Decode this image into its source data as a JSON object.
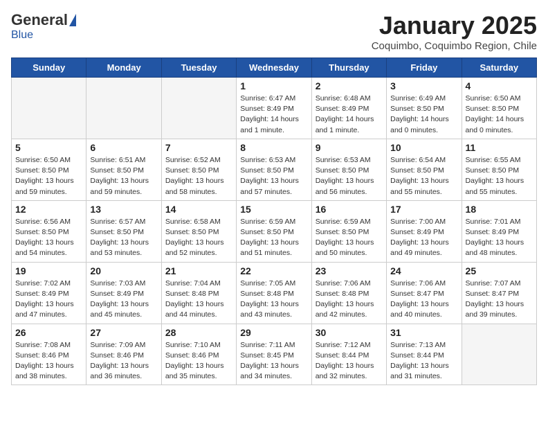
{
  "header": {
    "logo_general": "General",
    "logo_blue": "Blue",
    "title": "January 2025",
    "subtitle": "Coquimbo, Coquimbo Region, Chile"
  },
  "days_of_week": [
    "Sunday",
    "Monday",
    "Tuesday",
    "Wednesday",
    "Thursday",
    "Friday",
    "Saturday"
  ],
  "weeks": [
    [
      {
        "day": "",
        "info": ""
      },
      {
        "day": "",
        "info": ""
      },
      {
        "day": "",
        "info": ""
      },
      {
        "day": "1",
        "info": "Sunrise: 6:47 AM\nSunset: 8:49 PM\nDaylight: 14 hours\nand 1 minute."
      },
      {
        "day": "2",
        "info": "Sunrise: 6:48 AM\nSunset: 8:49 PM\nDaylight: 14 hours\nand 1 minute."
      },
      {
        "day": "3",
        "info": "Sunrise: 6:49 AM\nSunset: 8:50 PM\nDaylight: 14 hours\nand 0 minutes."
      },
      {
        "day": "4",
        "info": "Sunrise: 6:50 AM\nSunset: 8:50 PM\nDaylight: 14 hours\nand 0 minutes."
      }
    ],
    [
      {
        "day": "5",
        "info": "Sunrise: 6:50 AM\nSunset: 8:50 PM\nDaylight: 13 hours\nand 59 minutes."
      },
      {
        "day": "6",
        "info": "Sunrise: 6:51 AM\nSunset: 8:50 PM\nDaylight: 13 hours\nand 59 minutes."
      },
      {
        "day": "7",
        "info": "Sunrise: 6:52 AM\nSunset: 8:50 PM\nDaylight: 13 hours\nand 58 minutes."
      },
      {
        "day": "8",
        "info": "Sunrise: 6:53 AM\nSunset: 8:50 PM\nDaylight: 13 hours\nand 57 minutes."
      },
      {
        "day": "9",
        "info": "Sunrise: 6:53 AM\nSunset: 8:50 PM\nDaylight: 13 hours\nand 56 minutes."
      },
      {
        "day": "10",
        "info": "Sunrise: 6:54 AM\nSunset: 8:50 PM\nDaylight: 13 hours\nand 55 minutes."
      },
      {
        "day": "11",
        "info": "Sunrise: 6:55 AM\nSunset: 8:50 PM\nDaylight: 13 hours\nand 55 minutes."
      }
    ],
    [
      {
        "day": "12",
        "info": "Sunrise: 6:56 AM\nSunset: 8:50 PM\nDaylight: 13 hours\nand 54 minutes."
      },
      {
        "day": "13",
        "info": "Sunrise: 6:57 AM\nSunset: 8:50 PM\nDaylight: 13 hours\nand 53 minutes."
      },
      {
        "day": "14",
        "info": "Sunrise: 6:58 AM\nSunset: 8:50 PM\nDaylight: 13 hours\nand 52 minutes."
      },
      {
        "day": "15",
        "info": "Sunrise: 6:59 AM\nSunset: 8:50 PM\nDaylight: 13 hours\nand 51 minutes."
      },
      {
        "day": "16",
        "info": "Sunrise: 6:59 AM\nSunset: 8:50 PM\nDaylight: 13 hours\nand 50 minutes."
      },
      {
        "day": "17",
        "info": "Sunrise: 7:00 AM\nSunset: 8:49 PM\nDaylight: 13 hours\nand 49 minutes."
      },
      {
        "day": "18",
        "info": "Sunrise: 7:01 AM\nSunset: 8:49 PM\nDaylight: 13 hours\nand 48 minutes."
      }
    ],
    [
      {
        "day": "19",
        "info": "Sunrise: 7:02 AM\nSunset: 8:49 PM\nDaylight: 13 hours\nand 47 minutes."
      },
      {
        "day": "20",
        "info": "Sunrise: 7:03 AM\nSunset: 8:49 PM\nDaylight: 13 hours\nand 45 minutes."
      },
      {
        "day": "21",
        "info": "Sunrise: 7:04 AM\nSunset: 8:48 PM\nDaylight: 13 hours\nand 44 minutes."
      },
      {
        "day": "22",
        "info": "Sunrise: 7:05 AM\nSunset: 8:48 PM\nDaylight: 13 hours\nand 43 minutes."
      },
      {
        "day": "23",
        "info": "Sunrise: 7:06 AM\nSunset: 8:48 PM\nDaylight: 13 hours\nand 42 minutes."
      },
      {
        "day": "24",
        "info": "Sunrise: 7:06 AM\nSunset: 8:47 PM\nDaylight: 13 hours\nand 40 minutes."
      },
      {
        "day": "25",
        "info": "Sunrise: 7:07 AM\nSunset: 8:47 PM\nDaylight: 13 hours\nand 39 minutes."
      }
    ],
    [
      {
        "day": "26",
        "info": "Sunrise: 7:08 AM\nSunset: 8:46 PM\nDaylight: 13 hours\nand 38 minutes."
      },
      {
        "day": "27",
        "info": "Sunrise: 7:09 AM\nSunset: 8:46 PM\nDaylight: 13 hours\nand 36 minutes."
      },
      {
        "day": "28",
        "info": "Sunrise: 7:10 AM\nSunset: 8:46 PM\nDaylight: 13 hours\nand 35 minutes."
      },
      {
        "day": "29",
        "info": "Sunrise: 7:11 AM\nSunset: 8:45 PM\nDaylight: 13 hours\nand 34 minutes."
      },
      {
        "day": "30",
        "info": "Sunrise: 7:12 AM\nSunset: 8:44 PM\nDaylight: 13 hours\nand 32 minutes."
      },
      {
        "day": "31",
        "info": "Sunrise: 7:13 AM\nSunset: 8:44 PM\nDaylight: 13 hours\nand 31 minutes."
      },
      {
        "day": "",
        "info": ""
      }
    ]
  ]
}
